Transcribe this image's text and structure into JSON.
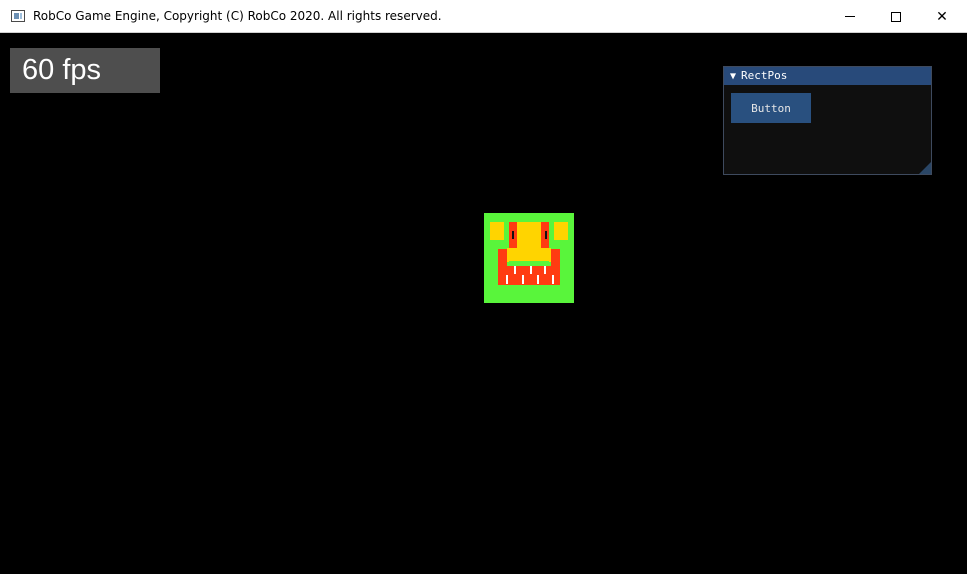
{
  "window": {
    "title": "RobCo Game Engine, Copyright (C) RobCo 2020. All rights reserved.",
    "icon": "app-window-icon",
    "controls": {
      "minimize_icon": "minimize-icon",
      "maximize_icon": "maximize-icon",
      "close_icon": "close-icon",
      "close_glyph": "✕"
    }
  },
  "hud": {
    "fps_text": "60 fps"
  },
  "debug_panel": {
    "title": "RectPos",
    "collapse_glyph": "▼",
    "button_label": "Button"
  },
  "sprite": {
    "description_icon": "monster-face-sprite",
    "colors": {
      "background": "#59f53b",
      "yellow": "#ffd400",
      "red": "#ff3b12",
      "dark": "#111111",
      "white": "#ffffff"
    }
  },
  "colors": {
    "titlebar": "#ffffff",
    "game_background": "#000000",
    "fps_background": "#4e4e4e",
    "panel_title": "#284a7a",
    "panel_button": "#29507f"
  }
}
